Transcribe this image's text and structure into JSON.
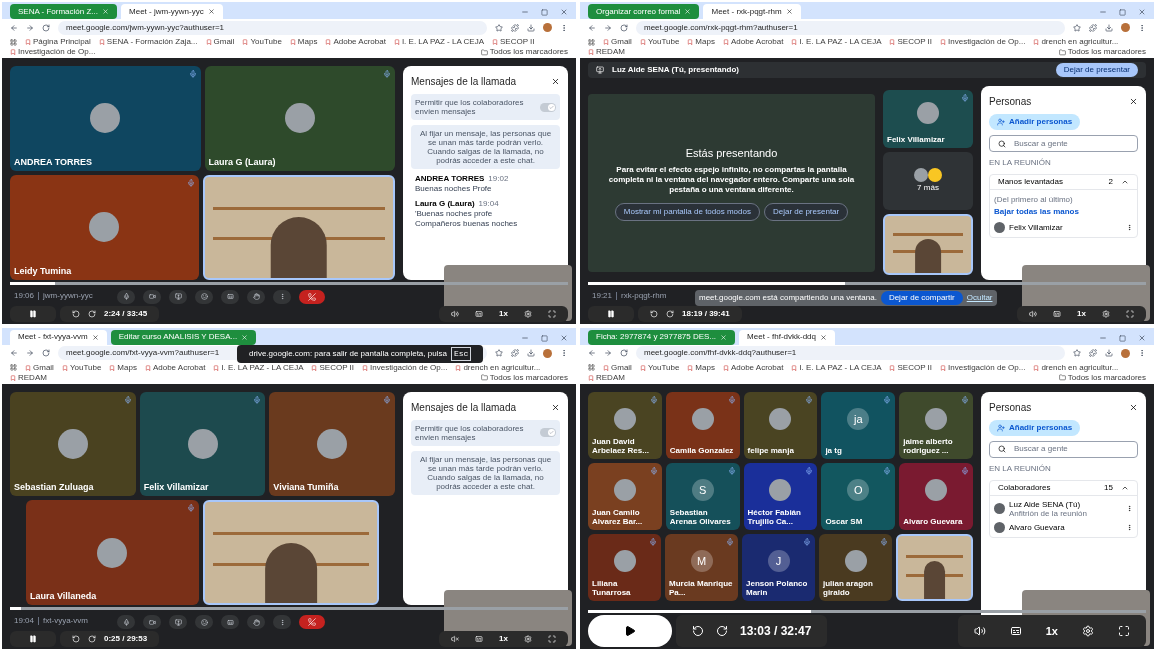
{
  "panels": [
    {
      "tabs": [
        {
          "label": "SENA - Formación Z...",
          "selected": false
        },
        {
          "label": "Meet - jwm-yywn-yyc",
          "selected": true
        }
      ],
      "address": "meet.google.com/jwm-yywn-yyc?authuser=1",
      "bookmarks": [
        "Página Principal",
        "SENA - Formación Zaja...",
        "Gmail",
        "YouTube",
        "Maps",
        "Adobe Acrobat",
        "I. E. LA PAZ - LA CEJA",
        "SECOP II",
        "Investigación de Op..."
      ],
      "all_bookmarks": "Todos los marcadores",
      "stage": {
        "kind": "grid",
        "rows": [
          [
            {
              "kind": "photo",
              "name": "ANDREA TORRES",
              "color": "#0f4660"
            },
            {
              "kind": "photo",
              "name": "Laura G (Laura)",
              "color": "#2e4a2b"
            }
          ],
          [
            {
              "kind": "photo",
              "name": "Leidy Tumina",
              "color": "#8a3414"
            },
            {
              "kind": "video"
            }
          ]
        ]
      },
      "side_panel": {
        "kind": "chat",
        "title": "Mensajes de la llamada",
        "toggle": {
          "label": "Permitir que los colaboradores envíen mensajes",
          "on": true
        },
        "info": "Al fijar un mensaje, las personas que se unan más tarde podrán verlo. Cuando salgas de la llamada, no podrás acceder a este chat.",
        "messages": [
          {
            "sender": "ANDREA TORRES",
            "time": "19:02",
            "lines": [
              "Buenas noches Profe"
            ]
          },
          {
            "sender": "Laura G (Laura)",
            "time": "19:04",
            "lines": [
              "'Buenas noches profe",
              "Compañeros buenas noches"
            ]
          }
        ]
      },
      "meet_toolbar": true,
      "meeting_time": "19:06",
      "meeting_code": "jwm-yywn-yyc",
      "player": {
        "kind": "compact",
        "playing": true,
        "muted": false,
        "level": 0.08,
        "elapsed": "2:24 / 33:45",
        "speed": "1x"
      }
    },
    {
      "tabs": [
        {
          "label": "Organizar correo formal",
          "selected": false
        },
        {
          "label": "Meet - rxk-pqgt-rhm",
          "selected": true
        }
      ],
      "address": "meet.google.com/rxk-pqgt-rhm?authuser=1",
      "bookmarks": [
        "Gmail",
        "YouTube",
        "Maps",
        "Adobe Acrobat",
        "I. E. LA PAZ - LA CEJA",
        "SECOP II",
        "Investigación de Op...",
        "drench en agricultur...",
        "REDAM"
      ],
      "all_bookmarks": "Todos los marcadores",
      "banner": {
        "text": "Luz Aide SENA (Tú, presentando)",
        "button": "Dejar de presentar"
      },
      "stage": {
        "kind": "presenting",
        "title": "Estás presentando",
        "body": "Para evitar el efecto espejo infinito, no compartas la pantalla completa ni la ventana del navegador entero. Comparte una sola pestaña o una ventana diferente.",
        "buttons": [
          "Mostrar mi pantalla de todos modos",
          "Dejar de presentar"
        ],
        "side_tiles": [
          {
            "kind": "photo",
            "name": "Felix Villamizar",
            "color": "#1d4d4f"
          },
          {
            "kind": "more",
            "name": "7 más",
            "color": "#2f3336"
          },
          {
            "kind": "video"
          }
        ]
      },
      "side_panel": {
        "kind": "people",
        "title": "Personas",
        "add_button": "Añadir personas",
        "search_placeholder": "Buscar a gente",
        "section": "EN LA REUNIÓN",
        "group": {
          "label": "Manos levantadas",
          "count": "2",
          "expanded": true
        },
        "note": "(Del primero al último)",
        "action": "Bajar todas las manos",
        "members": [
          {
            "name": "Felix Villamizar"
          }
        ]
      },
      "meet_toolbar": true,
      "meeting_time": "19:21",
      "meeting_code": "rxk-pqgt-rhm",
      "share_notice": {
        "text": "meet.google.com está compartiendo una ventana.",
        "buttons": [
          "Dejar de compartir",
          "Ocultar"
        ]
      },
      "player": {
        "kind": "compact",
        "playing": true,
        "muted": false,
        "level": 0.46,
        "elapsed": "18:19 / 39:41",
        "speed": "1x"
      }
    },
    {
      "tabs": [
        {
          "label": "Meet - fxt-vyya-vvm",
          "selected": true
        },
        {
          "label": "Editar curso ANALISIS Y DESA...",
          "selected": false
        }
      ],
      "address": "meet.google.com/fxt-vyya-vvm?authuser=1",
      "fullscreen_notice": {
        "text": "drive.google.com: para salir de pantalla completa, pulsa",
        "key": "Esc"
      },
      "bookmarks": [
        "Gmail",
        "YouTube",
        "Maps",
        "Adobe Acrobat",
        "I. E. LA PAZ - LA CEJA",
        "SECOP II",
        "Investigación de Op...",
        "drench en agricultur...",
        "REDAM"
      ],
      "all_bookmarks": "Todos los marcadores",
      "stage": {
        "kind": "grid",
        "rows": [
          [
            {
              "kind": "photo",
              "name": "Sebastian Zuluaga",
              "color": "#4a4220"
            },
            {
              "kind": "photo",
              "name": "Felix Villamizar",
              "color": "#1d4a4e"
            },
            {
              "kind": "photo",
              "name": "Viviana Tumiña",
              "color": "#6a3a1e"
            }
          ],
          [
            {
              "kind": "photo",
              "name": "Laura Villaneda",
              "color": "#7a3018"
            },
            {
              "kind": "video"
            }
          ]
        ]
      },
      "side_panel": {
        "kind": "chat",
        "title": "Mensajes de la llamada",
        "toggle": {
          "label": "Permitir que los colaboradores envíen mensajes",
          "on": true
        },
        "info": "Al fijar un mensaje, las personas que se unan más tarde podrán verlo. Cuando salgas de la llamada, no podrás acceder a este chat."
      },
      "meet_toolbar": true,
      "meeting_time": "19:04",
      "meeting_code": "fxt-vyya-vvm",
      "player": {
        "kind": "compact",
        "playing": true,
        "muted": true,
        "level": 0.02,
        "elapsed": "0:25 / 29:53",
        "speed": "1x"
      }
    },
    {
      "tabs": [
        {
          "label": "Ficha: 2977874 y 2977875 DES...",
          "selected": false
        },
        {
          "label": "Meet - fhf-dvkk-ddq",
          "selected": true
        }
      ],
      "address": "meet.google.com/fhf-dvkk-ddq?authuser=1",
      "bookmarks": [
        "Gmail",
        "YouTube",
        "Maps",
        "Adobe Acrobat",
        "I. E. LA PAZ - LA CEJA",
        "SECOP II",
        "Investigación de Op...",
        "drench en agricultur...",
        "REDAM"
      ],
      "all_bookmarks": "Todos los marcadores",
      "stage": {
        "kind": "grid",
        "rows": [
          [
            {
              "kind": "photo",
              "name": "Juan David Arbelaez Res...",
              "color": "#4a4422"
            },
            {
              "kind": "photo",
              "name": "Camila Gonzalez",
              "color": "#7a3218"
            },
            {
              "kind": "photo",
              "name": "felipe manja",
              "color": "#4a4422"
            },
            {
              "kind": "letter",
              "letter": "ja",
              "name": "ja tg",
              "color": "#115360"
            },
            {
              "kind": "photo",
              "name": "jaime alberto rodriguez ...",
              "color": "#3f4a2c"
            }
          ],
          [
            {
              "kind": "photo",
              "name": "Juan Camilo Alvarez Bar...",
              "color": "#7a4020"
            },
            {
              "kind": "letter",
              "letter": "S",
              "name": "Sebastian Arenas Olivares",
              "color": "#15505a"
            },
            {
              "kind": "photo",
              "name": "Héctor Fabián Trujillo Ca...",
              "color": "#1a2f9a"
            },
            {
              "kind": "letter",
              "letter": "O",
              "name": "Oscar SM",
              "color": "#12575f"
            },
            {
              "kind": "photo",
              "name": "Alvaro Guevara",
              "color": "#7a1a30"
            }
          ],
          [
            {
              "kind": "photo",
              "name": "Liliana Tunarrosa",
              "color": "#6a2a18"
            },
            {
              "kind": "letter",
              "letter": "M",
              "name": "Murcia Manrique Pa...",
              "color": "#6a3a20"
            },
            {
              "kind": "letter",
              "letter": "J",
              "name": "Jenson Polanco Marin",
              "color": "#1a2a70"
            },
            {
              "kind": "photo",
              "name": "julian aragon giraldo",
              "color": "#4a3a20"
            },
            {
              "kind": "video"
            }
          ]
        ]
      },
      "side_panel": {
        "kind": "people",
        "title": "Personas",
        "add_button": "Añadir personas",
        "search_placeholder": "Buscar a gente",
        "section": "EN LA REUNIÓN",
        "group": {
          "label": "Colaboradores",
          "count": "15",
          "expanded": true
        },
        "members": [
          {
            "name": "Luz Aide SENA (Tú)",
            "subtitle": "Anfitrión de la reunión"
          },
          {
            "name": "Alvaro Guevara"
          }
        ]
      },
      "meet_toolbar": false,
      "player": {
        "kind": "expanded",
        "playing": false,
        "muted": false,
        "level": 0.4,
        "elapsed": "13:03 / 32:47",
        "speed": "1x"
      }
    }
  ]
}
